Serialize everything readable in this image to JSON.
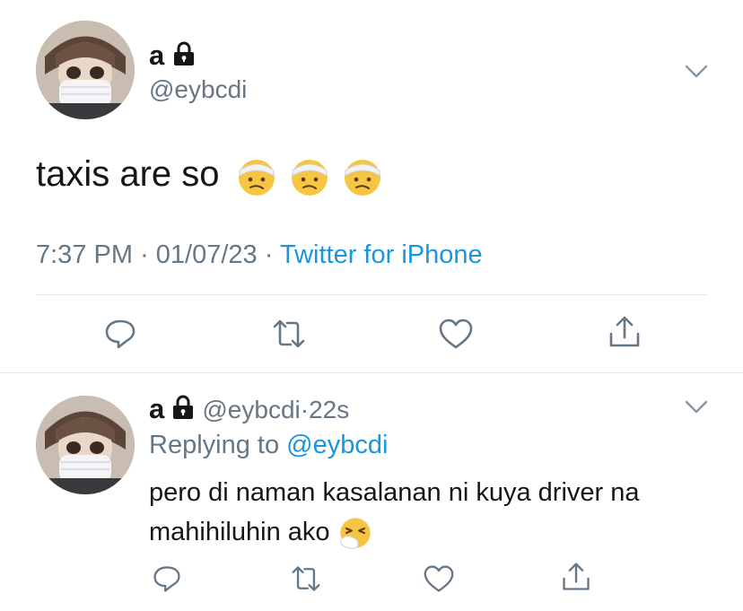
{
  "main_tweet": {
    "name": "a",
    "handle": "@eybcdi",
    "text": "taxis are so",
    "emojis": [
      "face-with-head-bandage",
      "face-with-head-bandage",
      "face-with-head-bandage"
    ],
    "time": "7:37 PM",
    "date": "01/07/23",
    "source": "Twitter for iPhone",
    "separator": "·"
  },
  "reply_tweet": {
    "name": "a",
    "handle": "@eybcdi",
    "age": "22s",
    "replying_label": "Replying to",
    "replying_handle": "@eybcdi",
    "text_line1": "pero di naman kasalanan ni kuya driver na",
    "text_line2": "mahihiluhin ako",
    "emoji": "sneezing-face"
  },
  "colors": {
    "link": "#1b95e0",
    "secondary": "#657786",
    "divider": "#e1e8ed",
    "text": "#14171a"
  },
  "icons": [
    "lock-icon",
    "chevron-down-icon",
    "reply-icon",
    "retweet-icon",
    "like-icon",
    "share-icon"
  ]
}
